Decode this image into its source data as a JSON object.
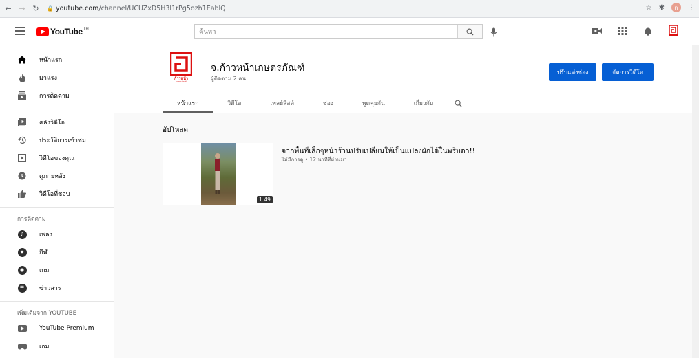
{
  "browser": {
    "url_host": "youtube.com",
    "url_path": "/channel/UCUZxD5H3l1rPg5ozh1EablQ",
    "profile_initial": "n"
  },
  "masthead": {
    "logo_text": "YouTube",
    "logo_country": "TH",
    "search_placeholder": "ค้นหา"
  },
  "sidebar": {
    "main_items": [
      {
        "label": "หน้าแรก",
        "icon": "home-icon"
      },
      {
        "label": "มาแรง",
        "icon": "trending-icon"
      },
      {
        "label": "การติดตาม",
        "icon": "subscriptions-icon"
      }
    ],
    "library_items": [
      {
        "label": "คลังวิดีโอ",
        "icon": "library-icon"
      },
      {
        "label": "ประวัติการเข้าชม",
        "icon": "history-icon"
      },
      {
        "label": "วิดีโอของคุณ",
        "icon": "your-videos-icon"
      },
      {
        "label": "ดูภายหลัง",
        "icon": "watch-later-icon"
      },
      {
        "label": "วิดีโอที่ชอบ",
        "icon": "liked-icon"
      }
    ],
    "subscriptions_heading": "การติดตาม",
    "subscriptions": [
      {
        "label": "เพลง",
        "icon": "music-icon"
      },
      {
        "label": "กีฬา",
        "icon": "sports-icon"
      },
      {
        "label": "เกม",
        "icon": "gaming-icon"
      },
      {
        "label": "ข่าวสาร",
        "icon": "news-icon"
      }
    ],
    "more_heading": "เพิ่มเติมจาก YOUTUBE",
    "more_items": [
      {
        "label": "YouTube Premium",
        "icon": "youtube-premium-icon"
      },
      {
        "label": "เกม",
        "icon": "gaming-icon"
      }
    ]
  },
  "channel": {
    "name": "จ.ก้าวหน้าเกษตรภัณฑ์",
    "subscribers": "ผู้ติดตาม 2 คน",
    "customize_button": "ปรับแต่งช่อง",
    "manage_button": "จัดการวิดีโอ",
    "avatar_text": "ก้าวหน้า",
    "avatar_subtext": "เกษตรภัณฑ์",
    "tabs": [
      "หน้าแรก",
      "วิดีโอ",
      "เพลย์ลิสต์",
      "ช่อง",
      "พูดคุยกัน",
      "เกี่ยวกับ"
    ]
  },
  "uploads": {
    "title": "อัปโหลด",
    "video": {
      "title": "จากพื้นที่เล็กๆหน้าร้านปรับเปลี่ยนให้เป็นแปลงผักได้ในพริบตา!!",
      "meta": "ไม่มีการดู • 12 นาทีที่ผ่านมา",
      "duration": "1:49"
    }
  },
  "colors": {
    "accent": "#065fd4",
    "brand": "#ff0000"
  }
}
